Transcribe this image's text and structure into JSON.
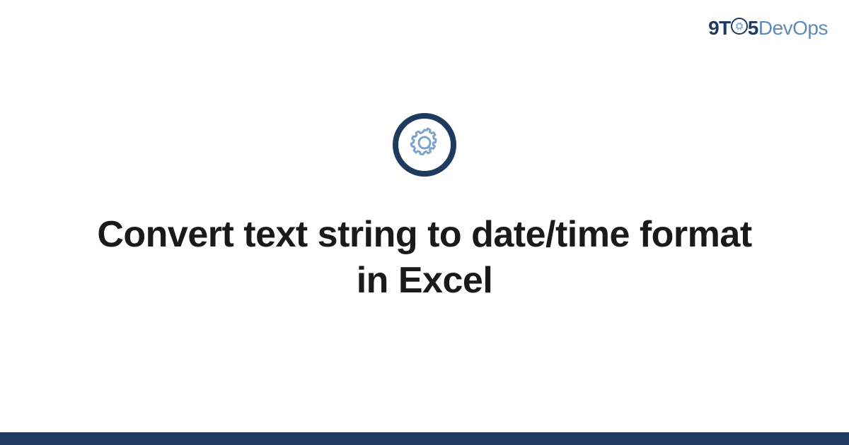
{
  "logo": {
    "part1": "9T",
    "part2": "5",
    "part3": "DevOps"
  },
  "icon": {
    "name": "gear-icon",
    "circle_color": "#1e3a5f",
    "gear_color": "#7da3c9"
  },
  "title": "Convert text string to date/time format in Excel",
  "footer_color": "#1e3a5f"
}
